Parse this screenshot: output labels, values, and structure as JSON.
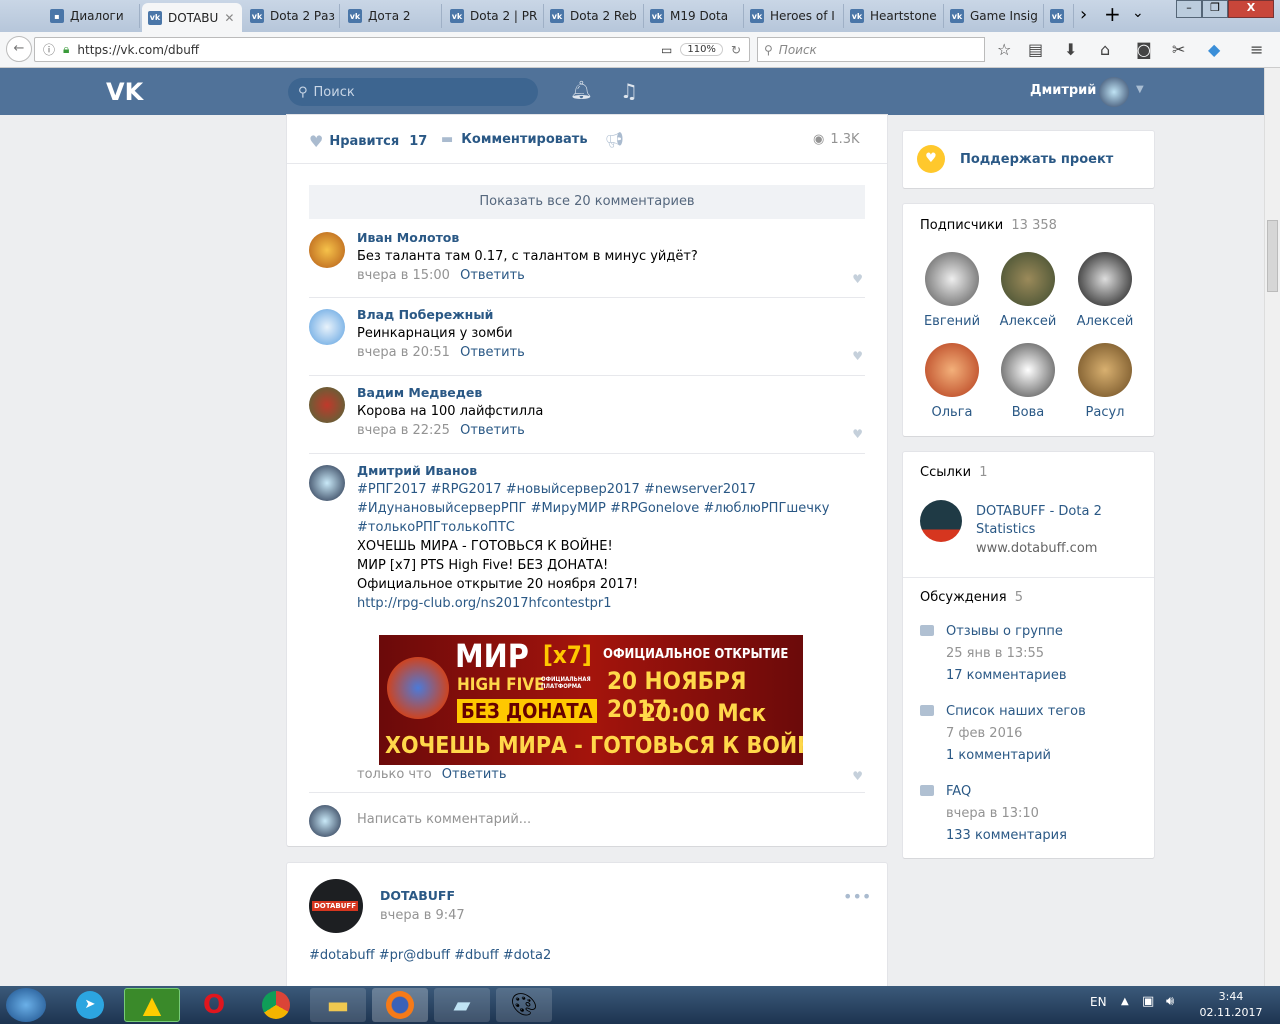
{
  "browser": {
    "tabs": [
      {
        "label": "Диалоги"
      },
      {
        "label": "DOTABU"
      },
      {
        "label": "Dota 2 Раз"
      },
      {
        "label": "Дота 2"
      },
      {
        "label": "Dota 2 | PR"
      },
      {
        "label": "Dota 2 Reb"
      },
      {
        "label": "M19 Dota"
      },
      {
        "label": "Heroes of I"
      },
      {
        "label": "Heartstone"
      },
      {
        "label": "Game Insig"
      }
    ],
    "url": "https://vk.com/dbuff",
    "zoom": "110%",
    "search_placeholder": "Поиск"
  },
  "vk": {
    "search_placeholder": "Поиск",
    "user_name": "Дмитрий",
    "post_actions": {
      "like_label": "Нравится",
      "like_count": "17",
      "comment_label": "Комментировать",
      "views": "1.3K"
    },
    "show_all": "Показать все 20 комментариев",
    "reply_label": "Ответить",
    "comments": [
      {
        "author": "Иван Молотов",
        "text": "Без таланта там 0.17, с талантом в минус уйдёт?",
        "time": "вчера в 15:00"
      },
      {
        "author": "Влад Побережный",
        "text": "Реинкарнация у зомби",
        "time": "вчера в 20:51"
      },
      {
        "author": "Вадим Медведев",
        "text": "Корова на 100 лайфстилла",
        "time": "вчера в 22:25"
      }
    ],
    "big_comment": {
      "author": "Дмитрий Иванов",
      "tags1": "#РПГ2017 #RPG2017 #новыйсервер2017 #newserver2017",
      "tags2": "#ИдунановыйсерверРПГ #МируМИР #RPGonelove #люблюРПГшечку",
      "tags3": "#толькоРПГтолькоПТС",
      "line1": "ХОЧЕШЬ МИРА - ГОТОВЬСЯ К ВОЙНЕ!",
      "line2": "МИР [x7] PTS High Five! БЕЗ ДОНАТА!",
      "line3": "Официальное открытие 20 ноября 2017!",
      "link": "http://rpg-club.org/ns2017hfcontestpr1",
      "banner": {
        "title": "МИР",
        "x7": "[x7]",
        "hf": "HIGH FIVE",
        "platform": "ОФИЦИАЛЬНАЯ ПЛАТФОРМА",
        "nodonate": "БЕЗ ДОНАТА",
        "open": "ОФИЦИАЛЬНОЕ ОТКРЫТИЕ",
        "date": "20 НОЯБРЯ 2017",
        "time": "20:00 Мск",
        "slogan": "ХОЧЕШЬ МИРА - ГОТОВЬСЯ К ВОЙНЕ"
      },
      "time": "только что"
    },
    "write_placeholder": "Написать комментарий...",
    "next_post": {
      "author": "DOTABUFF",
      "time": "вчера в 9:47",
      "text": "#dotabuff #pr@dbuff #dbuff #dota2",
      "avatar_text": "DOTABUFF"
    },
    "support": "Поддержать проект",
    "subscribers": {
      "title": "Подписчики",
      "count": "13 358",
      "people": [
        "Евгений",
        "Алексей",
        "Алексей",
        "Ольга",
        "Вова",
        "Расул"
      ]
    },
    "links": {
      "title": "Ссылки",
      "count": "1",
      "name": "DOTABUFF - Dota 2 Statistics",
      "url": "www.dotabuff.com"
    },
    "discussions": {
      "title": "Обсуждения",
      "count": "5",
      "items": [
        {
          "title": "Отзывы о группе",
          "date": "25 янв в 13:55",
          "comments": "17 комментариев"
        },
        {
          "title": "Список наших тегов",
          "date": "7 фев 2016",
          "comments": "1 комментарий"
        },
        {
          "title": "FAQ",
          "date": "вчера в 13:10",
          "comments": "133 комментария"
        }
      ]
    }
  },
  "taskbar": {
    "lang": "EN",
    "time": "3:44",
    "date": "02.11.2017"
  }
}
